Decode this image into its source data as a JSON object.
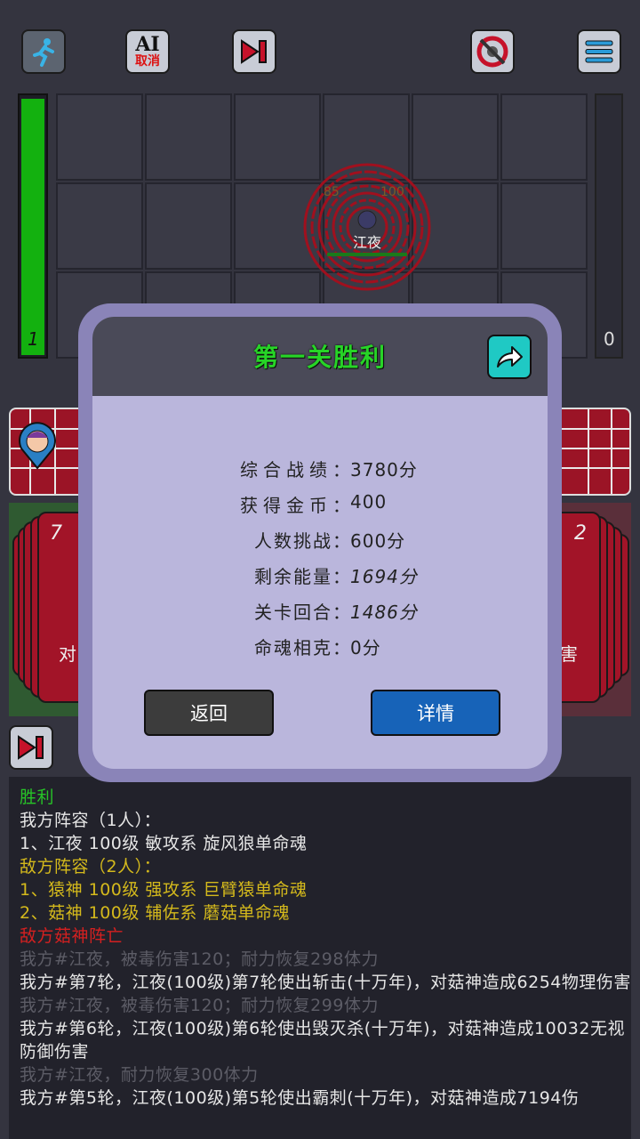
{
  "topbar": {
    "ai_line1": "AI",
    "ai_line2": "取消"
  },
  "hp_bar": {
    "value_label": "1",
    "fill_fraction": 1.0,
    "color": "#13b10f"
  },
  "enemy_count_label": "0",
  "boss": {
    "name": "江夜",
    "tag_left": "85",
    "tag_right": "100"
  },
  "cards_left": {
    "count": "7",
    "text": "对"
  },
  "cards_right": {
    "count": "2",
    "text": "害"
  },
  "dialog": {
    "title": "第一关胜利",
    "stats": [
      {
        "label": "综合战绩",
        "value": "3780分"
      },
      {
        "label": "获得金币",
        "value": "400"
      },
      {
        "label": "人数挑战",
        "value": "600分"
      },
      {
        "label": "剩余能量",
        "value": "1694分"
      },
      {
        "label": "关卡回合",
        "value": "1486分"
      },
      {
        "label": "命魂相克",
        "value": "0分"
      }
    ],
    "back_label": "返回",
    "detail_label": "详情"
  },
  "log": [
    {
      "text": "胜利",
      "color": "#27c427"
    },
    {
      "text": "我方阵容（1人）：",
      "color": "#e6e6e6"
    },
    {
      "text": "1、江夜 100级 敏攻系 旋风狼单命魂",
      "color": "#e6e6e6"
    },
    {
      "text": "敌方阵容（2人）：",
      "color": "#d4b91c"
    },
    {
      "text": "1、猿神 100级 强攻系 巨臂猿单命魂",
      "color": "#d4b91c"
    },
    {
      "text": "2、菇神 100级 辅佐系 蘑菇单命魂",
      "color": "#d4b91c"
    },
    {
      "text": "敌方菇神阵亡",
      "color": "#d42020"
    },
    {
      "text": "我方#江夜，被毒伤害120；耐力恢复298体力",
      "color": "#5c5c66"
    },
    {
      "text": "我方#第7轮，江夜(100级)第7轮使出斩击(十万年)，对菇神造成6254物理伤害",
      "color": "#e6e6e6"
    },
    {
      "text": "我方#江夜，被毒伤害120；耐力恢复299体力",
      "color": "#5c5c66"
    },
    {
      "text": "我方#第6轮，江夜(100级)第6轮使出毁灭杀(十万年)，对菇神造成10032无视防御伤害",
      "color": "#e6e6e6"
    },
    {
      "text": "我方#江夜，耐力恢复300体力",
      "color": "#5c5c66"
    },
    {
      "text": "我方#第5轮，江夜(100级)第5轮使出霸刺(十万年)，对菇神造成7194伤",
      "color": "#e6e6e6"
    }
  ],
  "colors": {
    "accent_green": "#27c427",
    "dialog_frame": "#8a84b8",
    "dialog_body": "#bab6dc",
    "dialog_header": "#4a4a58",
    "detail_button": "#1763b8",
    "back_button": "#3c3c3c",
    "share_button": "#1fc9c4",
    "card_red": "#a21428"
  }
}
